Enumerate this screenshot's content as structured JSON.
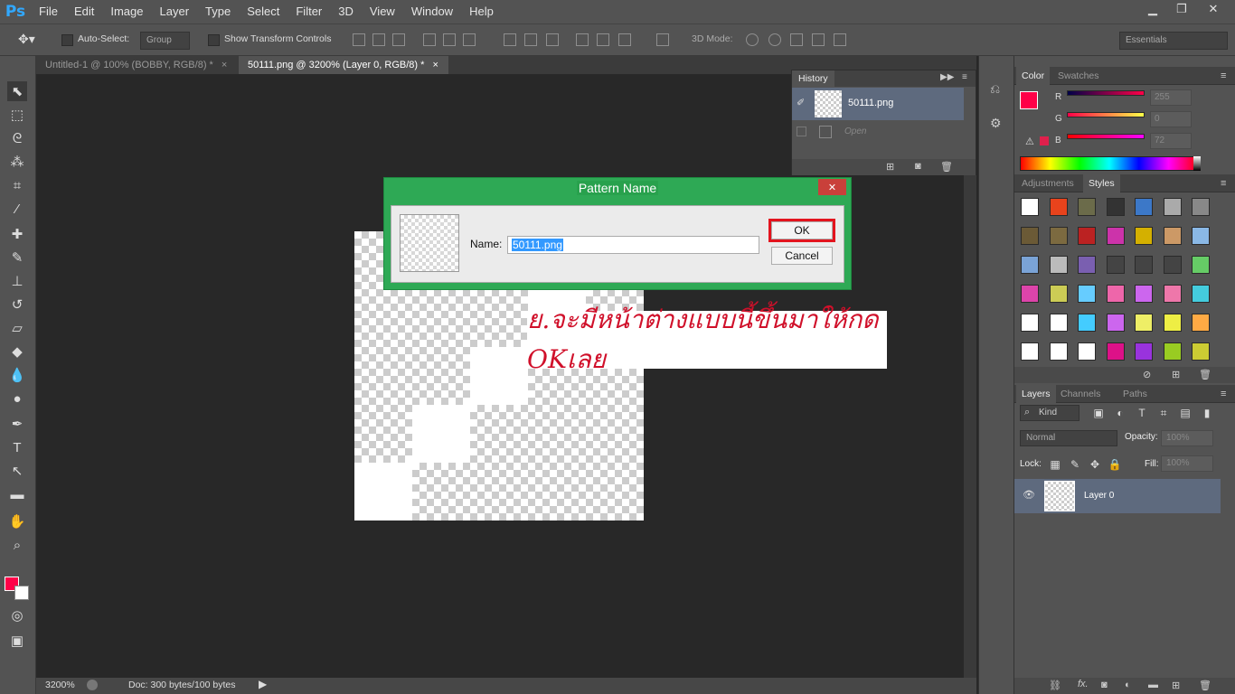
{
  "app": {
    "logo": "Ps"
  },
  "menu": [
    "File",
    "Edit",
    "Image",
    "Layer",
    "Type",
    "Select",
    "Filter",
    "3D",
    "View",
    "Window",
    "Help"
  ],
  "window_controls": {
    "minimize": "▁",
    "restore": "❐",
    "close": "✕"
  },
  "options": {
    "auto_select_label": "Auto-Select:",
    "auto_select_value": "Group",
    "show_transform_label": "Show Transform Controls",
    "mode_3d_label": "3D Mode:",
    "workspace": "Essentials"
  },
  "tabs": [
    {
      "label": "Untitled-1 @ 100% (BOBBY, RGB/8) *",
      "close": "×"
    },
    {
      "label": "50111.png @ 3200% (Layer 0, RGB/8) *",
      "close": "×"
    }
  ],
  "status": {
    "zoom": "3200%",
    "doc": "Doc: 300 bytes/100 bytes"
  },
  "history": {
    "tab": "History",
    "snapshot_name": "50111.png",
    "step": "Open"
  },
  "color_panel": {
    "tabs": [
      "Color",
      "Swatches"
    ],
    "r_label": "R",
    "g_label": "G",
    "b_label": "B",
    "r": "255",
    "g": "0",
    "b": "72",
    "fg_color": "#ff0048"
  },
  "styles_panel": {
    "tabs": [
      "Adjustments",
      "Styles"
    ]
  },
  "layers_panel": {
    "tabs": [
      "Layers",
      "Channels",
      "Paths"
    ],
    "kind_label": "Kind",
    "blend_mode": "Normal",
    "opacity_label": "Opacity:",
    "opacity": "100%",
    "lock_label": "Lock:",
    "fill_label": "Fill:",
    "fill": "100%",
    "layer_name": "Layer 0"
  },
  "dialog": {
    "title": "Pattern Name",
    "name_label": "Name:",
    "name_value": "50111.png",
    "ok": "OK",
    "cancel": "Cancel",
    "close": "✕"
  },
  "annotation": {
    "text": "ย.จะมีหน้าต่างแบบนี้ขึ้นมาให้กด OKเลย"
  }
}
